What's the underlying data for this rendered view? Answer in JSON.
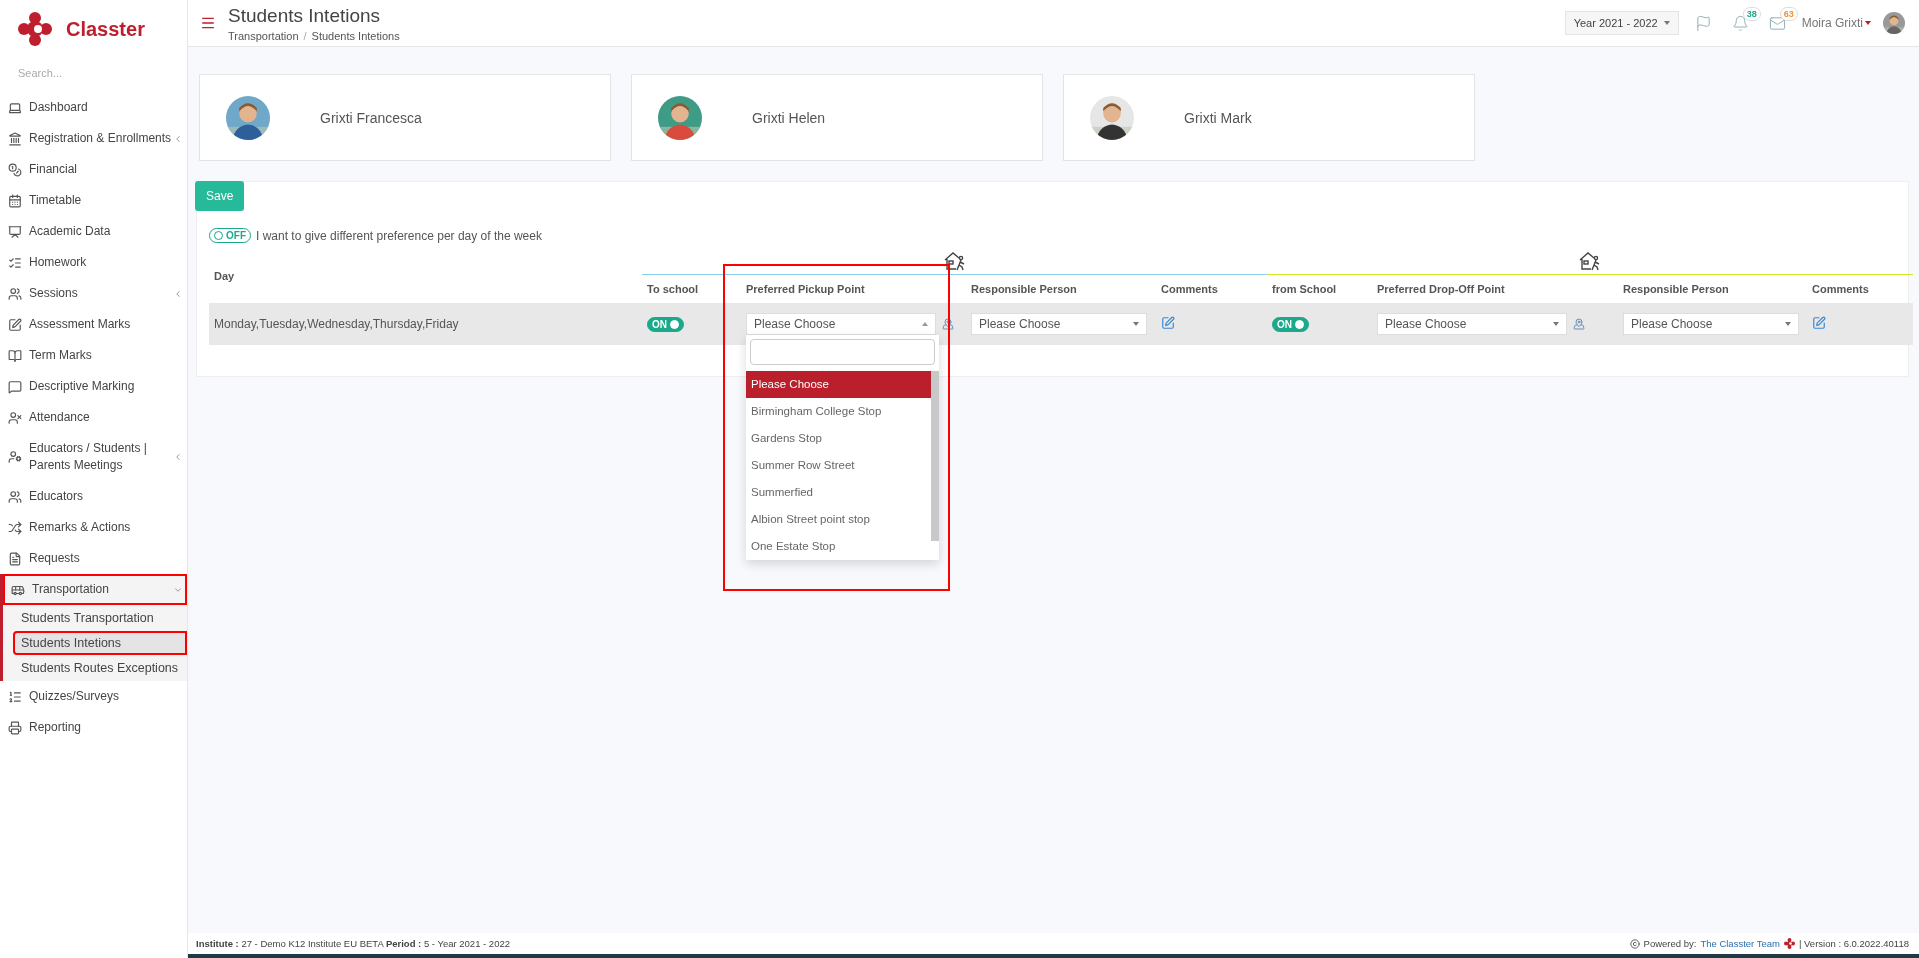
{
  "brand": "Classter",
  "sidebar": {
    "search": {
      "placeholder": "Search..."
    },
    "items": [
      {
        "label": "Dashboard",
        "annotated": false
      },
      {
        "label": "Registration & Enrollments",
        "expanded": false,
        "annotated": false
      },
      {
        "label": "Financial",
        "annotated": false
      },
      {
        "label": "Timetable",
        "annotated": false
      },
      {
        "label": "Academic Data",
        "annotated": false
      },
      {
        "label": "Homework",
        "annotated": false
      },
      {
        "label": "Sessions",
        "expanded": false,
        "annotated": false
      },
      {
        "label": "Assessment Marks",
        "annotated": false
      },
      {
        "label": "Term Marks",
        "annotated": false
      },
      {
        "label": "Descriptive Marking",
        "annotated": false
      },
      {
        "label": "Attendance",
        "annotated": false
      },
      {
        "label": "Educators / Students | Parents Meetings",
        "expanded": false,
        "annotated": false
      },
      {
        "label": "Educators",
        "annotated": false
      },
      {
        "label": "Remarks & Actions",
        "annotated": false
      },
      {
        "label": "Requests",
        "annotated": false
      },
      {
        "label": "Transportation",
        "expanded": true,
        "annotated": true,
        "children": [
          {
            "label": "Students Transportation",
            "selected": false,
            "annotated": false
          },
          {
            "label": "Students Intetions",
            "selected": true,
            "annotated": true
          },
          {
            "label": "Students Routes Exceptions",
            "selected": false,
            "annotated": false
          }
        ]
      },
      {
        "label": "Quizzes/Surveys",
        "annotated": false
      },
      {
        "label": "Reporting",
        "annotated": false
      }
    ]
  },
  "header": {
    "title": "Students Intetions",
    "breadcrumb": [
      "Transportation",
      "Students Intetions"
    ],
    "breadcrumb_separator": "/",
    "year": "Year 2021 - 2022",
    "notifications": [
      {
        "kind": "bell",
        "count": "38",
        "color": "#1aa98a"
      },
      {
        "kind": "mail",
        "count": "63",
        "color": "#f0923a"
      }
    ],
    "user": "Moira Grixti"
  },
  "students": [
    {
      "name": "Grixti Francesca"
    },
    {
      "name": "Grixti Helen"
    },
    {
      "name": "Grixti Mark"
    }
  ],
  "form": {
    "save": "Save",
    "preference_toggle": {
      "on": false,
      "label": "OFF"
    },
    "preference_text": "I want to give different preference per day of the week",
    "table": {
      "day_column": "Day",
      "groups": [
        {
          "color": "#8ccfee",
          "columns": [
            "To school",
            "Preferred Pickup Point",
            "Responsible Person",
            "Comments"
          ]
        },
        {
          "color": "#d2ea2e",
          "columns": [
            "from School",
            "Preferred Drop-Off Point",
            "Responsible Person",
            "Comments"
          ]
        }
      ],
      "rows": [
        {
          "day": "Monday,Tuesday,Wednesday,Thursday,Friday",
          "groups": [
            {
              "toggle": {
                "on": true,
                "label": "ON"
              },
              "point": {
                "value": "Please Choose",
                "open": true,
                "annotated": true,
                "options": [
                  {
                    "label": "Please Choose",
                    "selected": true
                  },
                  {
                    "label": "Birmingham College Stop",
                    "selected": false
                  },
                  {
                    "label": "Gardens Stop",
                    "selected": false
                  },
                  {
                    "label": "Summer Row Street",
                    "selected": false
                  },
                  {
                    "label": "Summerfied",
                    "selected": false
                  },
                  {
                    "label": "Albion Street point stop",
                    "selected": false
                  },
                  {
                    "label": "One Estate Stop",
                    "selected": false
                  }
                ]
              },
              "responsible": {
                "value": "Please Choose"
              }
            },
            {
              "toggle": {
                "on": true,
                "label": "ON"
              },
              "point": {
                "value": "Please Choose",
                "open": false
              },
              "responsible": {
                "value": "Please Choose"
              }
            }
          ]
        }
      ]
    }
  },
  "footer": {
    "info": "**Institute :** 27 - Demo K12 Institute EU BETA **Period :** 5 - Year 2021 - 2022",
    "powered": "Powered by:",
    "team": "The Classter Team",
    "version": "| Version : 6.0.2022.40118"
  }
}
